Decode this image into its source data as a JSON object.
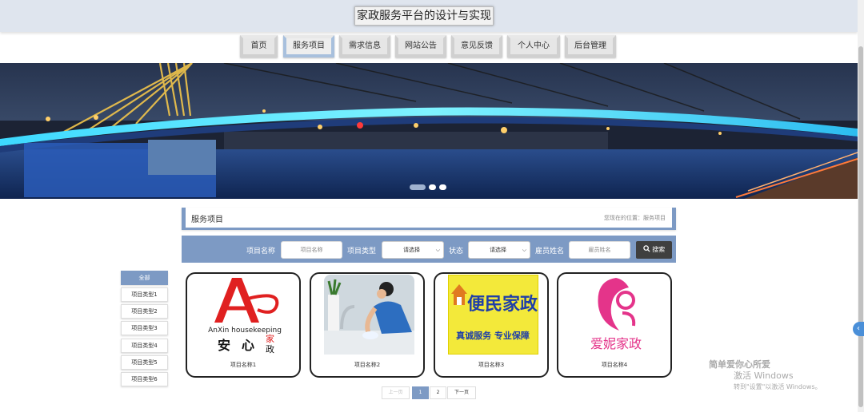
{
  "site": {
    "title": "家政服务平台的设计与实现"
  },
  "nav": {
    "items": [
      {
        "label": "首页"
      },
      {
        "label": "服务项目"
      },
      {
        "label": "需求信息"
      },
      {
        "label": "网站公告"
      },
      {
        "label": "意见反馈"
      },
      {
        "label": "个人中心"
      },
      {
        "label": "后台管理"
      }
    ],
    "active_index": 1
  },
  "banner": {
    "slides": 3,
    "active_slide": 1
  },
  "breadcrumb": {
    "title": "服务项目",
    "location": "您现在的位置：服务项目"
  },
  "search": {
    "name_label": "项目名称",
    "name_placeholder": "项目名称",
    "type_label": "项目类型",
    "type_value": "请选择",
    "status_label": "状态",
    "status_value": "请选择",
    "employee_label": "雇员姓名",
    "employee_placeholder": "雇员姓名",
    "button_label": "搜索"
  },
  "categories": [
    {
      "label": "全部",
      "active": true
    },
    {
      "label": "项目类型1"
    },
    {
      "label": "项目类型2"
    },
    {
      "label": "项目类型3"
    },
    {
      "label": "项目类型4"
    },
    {
      "label": "项目类型5"
    },
    {
      "label": "项目类型6"
    }
  ],
  "cards": [
    {
      "name": "项目名称1",
      "logo": {
        "brand": "AnXin housekeeping",
        "cn_1": "安",
        "cn_2": "心",
        "cn_3": "家",
        "cn_4": "政"
      }
    },
    {
      "name": "项目名称2",
      "image": "cleaning-photo"
    },
    {
      "name": "项目名称3",
      "logo": {
        "title": "便民家政",
        "slogan": "真诚服务   专业保障"
      }
    },
    {
      "name": "项目名称4",
      "logo": {
        "title": "爱妮家政"
      }
    }
  ],
  "pagination": {
    "prev": "上一页",
    "pages": [
      "1",
      "2"
    ],
    "current": "1",
    "next": "下一页"
  },
  "watermark": {
    "line1": "简单爱你心所爱",
    "line2": "激活 Windows",
    "line3": "转到\"设置\"以激活 Windows。"
  },
  "colors": {
    "accent": "#7d9ac4",
    "topbar": "#dfe5ee",
    "search_button": "#3f3f3f"
  }
}
